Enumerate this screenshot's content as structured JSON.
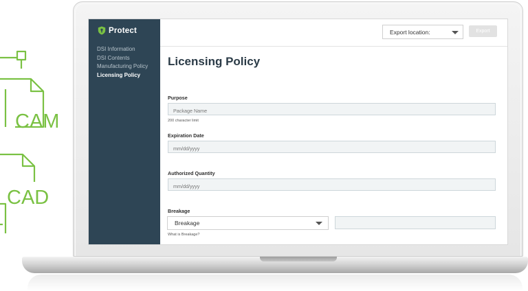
{
  "app": {
    "name": "Protect",
    "accent_color": "#7ac143",
    "sidebar_color": "#2e4555"
  },
  "sidebar": {
    "items": [
      {
        "label": "DSI Information",
        "active": false
      },
      {
        "label": "DSI Contents",
        "active": false
      },
      {
        "label": "Manufacturing Policy",
        "active": false
      },
      {
        "label": "Licensing Policy",
        "active": true
      }
    ]
  },
  "topbar": {
    "export_location_label": "Export location:",
    "export_button_label": "Export"
  },
  "main": {
    "title": "Licensing Policy",
    "purpose": {
      "label": "Purpose",
      "placeholder": "Package Name",
      "hint": "200 character limit"
    },
    "expiration": {
      "label": "Expiration Date",
      "placeholder": "mm/dd/yyyy"
    },
    "quantity": {
      "label": "Authorized Quantity",
      "placeholder": "mm/dd/yyyy"
    },
    "breakage": {
      "label": "Breakage",
      "selected": "Breakage",
      "hint": "What is Breakage?",
      "value": ""
    }
  },
  "decor": {
    "label_cam": "CAM",
    "label_cad": "CAD"
  },
  "icons": [
    "shield-icon",
    "chevron-down-icon",
    "cam-file-icon",
    "cad-file-icon"
  ]
}
